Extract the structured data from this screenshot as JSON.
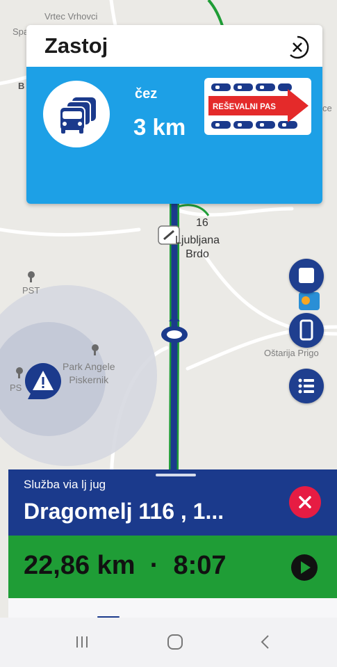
{
  "map": {
    "labels": {
      "top_left": "Vrtec Vrhovci",
      "spa": "Spa",
      "b": "B",
      "pst1": "PST",
      "pst2": "PS",
      "park": "Park Angele\nPiskernik",
      "station_num": "16",
      "station": "Ljubljana\nBrdo",
      "ostarija": "Oštarija Prigo",
      "ce": "ce"
    },
    "icons": [
      "tree-icon",
      "car-position-icon",
      "train-station-icon",
      "warning-icon"
    ]
  },
  "alert": {
    "title": "Zastoj",
    "via": "čez",
    "distance": "3 km",
    "lane_sign_text": "REŠEVALNI PAS",
    "colors": {
      "banner": "#1da0e6",
      "sign_arrow": "#e42a2a"
    }
  },
  "controls": {
    "stop_icon": "stop-square-icon",
    "screen_icon": "phone-screen-icon",
    "list_icon": "list-icon"
  },
  "route": {
    "subtitle": "Služba via lj jug",
    "destination": "Dragomelj 116 , 1...",
    "eta": "22,86 km  ·  8:07",
    "colors": {
      "route_panel": "#1b3a8c",
      "eta_panel": "#1f9d36",
      "cancel": "#e61c43"
    }
  },
  "navbar": {
    "icons": [
      "recent-apps-icon",
      "home-icon",
      "back-icon"
    ]
  }
}
